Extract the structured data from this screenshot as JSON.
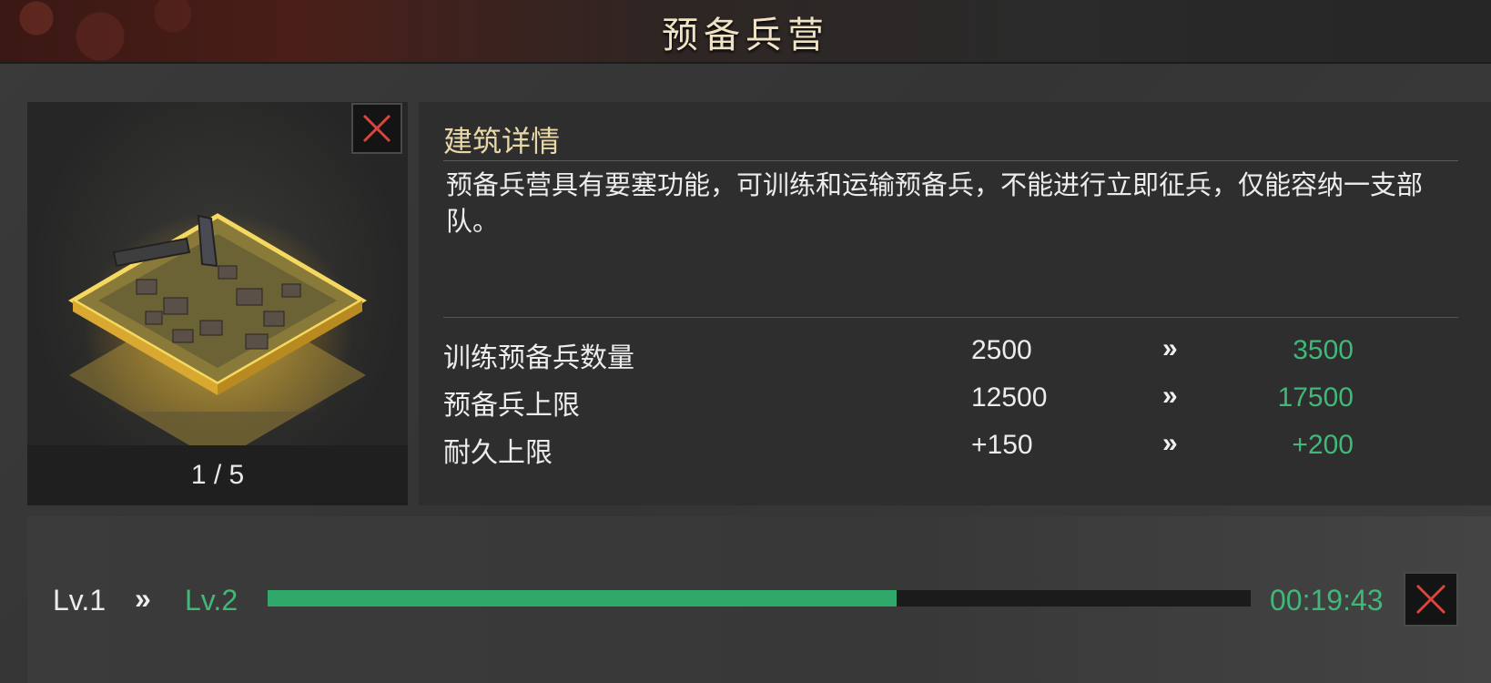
{
  "window": {
    "title": "预备兵营"
  },
  "preview": {
    "pager": "1 / 5",
    "close_icon": "close-x-icon"
  },
  "details": {
    "heading": "建筑详情",
    "description": "预备兵营具有要塞功能，可训练和运输预备兵，不能进行立即征兵，仅能容纳一支部队。",
    "stats": [
      {
        "label": "训练预备兵数量",
        "current": "2500",
        "next": "3500"
      },
      {
        "label": "预备兵上限",
        "current": "12500",
        "next": "17500"
      },
      {
        "label": "耐久上限",
        "current": "+150",
        "next": "+200"
      }
    ],
    "arrow": "»"
  },
  "upgrade": {
    "current_level": "Lv.1",
    "arrow": "»",
    "next_level": "Lv.2",
    "progress_fraction": 0.64,
    "time_remaining": "00:19:43"
  },
  "colors": {
    "accent_green": "#3fb878",
    "progress_fill": "#2fa86a",
    "close_red": "#d9453a",
    "heading_gold": "#e8d8a8"
  }
}
